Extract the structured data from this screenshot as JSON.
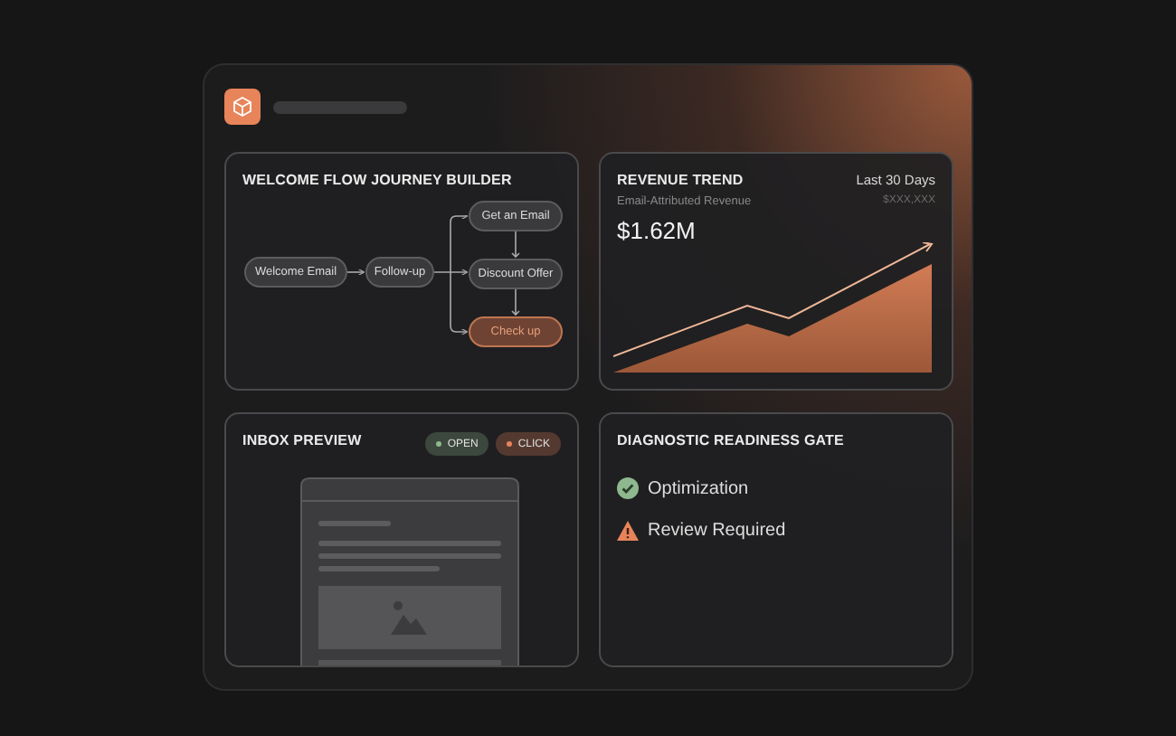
{
  "flow": {
    "title": "WELCOME FLOW JOURNEY BUILDER",
    "nodes": [
      {
        "label": "Welcome Email",
        "highlighted": false
      },
      {
        "label": "Follow-up",
        "highlighted": false
      },
      {
        "label": "Get an Email",
        "highlighted": false
      },
      {
        "label": "Discount Offer",
        "highlighted": false
      },
      {
        "label": "Check up",
        "highlighted": true
      }
    ]
  },
  "revenue": {
    "title": "REVENUE TREND",
    "period": "Last 30 Days",
    "subtitle": "Email-Attributed Revenue",
    "range": "$XXX,XXX",
    "value": "$1.62M"
  },
  "inbox": {
    "title": "INBOX PREVIEW",
    "badges": [
      {
        "label": "OPEN",
        "color": "#8fb88f"
      },
      {
        "label": "CLICK",
        "color": "#e8845a"
      }
    ]
  },
  "diagnostic": {
    "title": "DIAGNOSTIC READINESS GATE",
    "items": [
      {
        "kind": "ok",
        "label": "Optimization"
      },
      {
        "kind": "warning",
        "label": "Review Required"
      }
    ]
  }
}
